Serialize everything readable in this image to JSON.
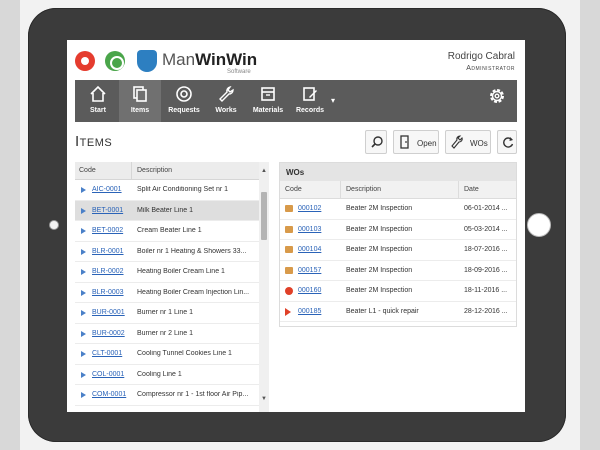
{
  "app": {
    "brand_light": "Man",
    "brand_bold": "WinWin",
    "brand_sub": "Software",
    "user_name": "Rodrigo Cabral",
    "user_role": "Administrator"
  },
  "nav": {
    "items": [
      {
        "label": "Start",
        "icon": "home-icon"
      },
      {
        "label": "Items",
        "icon": "items-icon"
      },
      {
        "label": "Requests",
        "icon": "lifebuoy-icon"
      },
      {
        "label": "Works",
        "icon": "wrench-icon"
      },
      {
        "label": "Materials",
        "icon": "box-icon"
      },
      {
        "label": "Records",
        "icon": "edit-icon"
      }
    ],
    "more_caret": "▾",
    "settings_icon": "gear-icon"
  },
  "page": {
    "title": "Items"
  },
  "toolbar": {
    "search_icon": "search-icon",
    "open_label": "Open",
    "wos_label": "WOs",
    "refresh_icon": "refresh-icon"
  },
  "items_table": {
    "headers": {
      "code": "Code",
      "description": "Description"
    },
    "rows": [
      {
        "code": "AIC-0001",
        "desc": "Split Air Conditioning Set nr 1"
      },
      {
        "code": "BET-0001",
        "desc": "Milk Beater Line 1"
      },
      {
        "code": "BET-0002",
        "desc": "Cream Beater Line 1"
      },
      {
        "code": "BLR-0001",
        "desc": "Boiler nr 1 Heating & Showers 33..."
      },
      {
        "code": "BLR-0002",
        "desc": "Heating Boiler Cream Line 1"
      },
      {
        "code": "BLR-0003",
        "desc": "Heating Boiler Cream Injection Lin..."
      },
      {
        "code": "BUR-0001",
        "desc": "Burner nr 1 Line 1"
      },
      {
        "code": "BUR-0002",
        "desc": "Burner nr 2 Line 1"
      },
      {
        "code": "CLT-0001",
        "desc": "Cooling Tunnel Cookies Line 1"
      },
      {
        "code": "COL-0001",
        "desc": "Cooling Line 1"
      },
      {
        "code": "COM-0001",
        "desc": "Compressor nr 1 - 1st floor Air Pip..."
      }
    ]
  },
  "wos_panel": {
    "title": "WOs",
    "headers": {
      "code": "Code",
      "description": "Description",
      "date": "Date"
    },
    "rows": [
      {
        "code": "000102",
        "desc": "Beater 2M Inspection",
        "date": "06-01-2014 ...",
        "status": "box"
      },
      {
        "code": "000103",
        "desc": "Beater 2M Inspection",
        "date": "05-03-2014 ...",
        "status": "box"
      },
      {
        "code": "000104",
        "desc": "Beater 2M Inspection",
        "date": "18-07-2016 ...",
        "status": "box"
      },
      {
        "code": "000157",
        "desc": "Beater 2M Inspection",
        "date": "18-09-2016 ...",
        "status": "box"
      },
      {
        "code": "000160",
        "desc": "Beater 2M Inspection",
        "date": "18-11-2016 ...",
        "status": "dot"
      },
      {
        "code": "000185",
        "desc": "Beater L1 - quick repair",
        "date": "28-12-2016 ...",
        "status": "tri"
      }
    ]
  }
}
